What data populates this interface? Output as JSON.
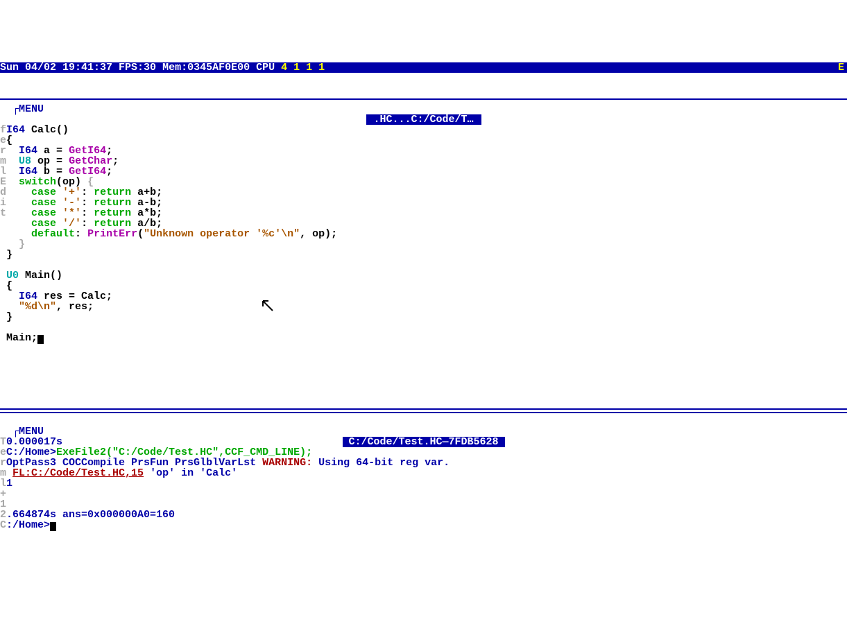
{
  "status": {
    "datetime": "Sun 04/02 19:41:37",
    "fps": "FPS:30",
    "mem": "Mem:0345AF0E00",
    "cpu_label": "CPU",
    "cpu_values": "4 1 1 1",
    "right": "E"
  },
  "editor": {
    "menu_label": "┌MENU",
    "side_text": "Term\nlEdit",
    "title": " .HC...C:/Code/T… ",
    "lines": [
      {
        "side": "f",
        "seg": [
          [
            "blue",
            "I64 "
          ],
          [
            "black",
            "Calc()"
          ]
        ]
      },
      {
        "side": "e",
        "seg": [
          [
            "black",
            "{"
          ]
        ]
      },
      {
        "side": "r",
        "seg": [
          [
            "black",
            "  "
          ],
          [
            "blue",
            "I64 "
          ],
          [
            "black",
            "a = "
          ],
          [
            "purple",
            "GetI64"
          ],
          [
            "black",
            ";"
          ]
        ]
      },
      {
        "side": "m",
        "seg": [
          [
            "black",
            "  "
          ],
          [
            "cyan",
            "U8 "
          ],
          [
            "black",
            "op = "
          ],
          [
            "purple",
            "GetChar"
          ],
          [
            "black",
            ";"
          ]
        ]
      },
      {
        "side": "l",
        "seg": [
          [
            "black",
            "  "
          ],
          [
            "blue",
            "I64 "
          ],
          [
            "black",
            "b = "
          ],
          [
            "purple",
            "GetI64"
          ],
          [
            "black",
            ";"
          ]
        ]
      },
      {
        "side": "E",
        "seg": [
          [
            "black",
            "  "
          ],
          [
            "green",
            "switch"
          ],
          [
            "black",
            "(op) "
          ],
          [
            "gray",
            "{"
          ]
        ]
      },
      {
        "side": "d",
        "seg": [
          [
            "black",
            "    "
          ],
          [
            "green",
            "case "
          ],
          [
            "dkyellow",
            "'+'"
          ],
          [
            "black",
            ": "
          ],
          [
            "green",
            "return "
          ],
          [
            "black",
            "a+b;"
          ]
        ]
      },
      {
        "side": "i",
        "seg": [
          [
            "black",
            "    "
          ],
          [
            "green",
            "case "
          ],
          [
            "dkyellow",
            "'-'"
          ],
          [
            "black",
            ": "
          ],
          [
            "green",
            "return "
          ],
          [
            "black",
            "a-b;"
          ]
        ]
      },
      {
        "side": "t",
        "seg": [
          [
            "black",
            "    "
          ],
          [
            "green",
            "case "
          ],
          [
            "dkyellow",
            "'*'"
          ],
          [
            "black",
            ": "
          ],
          [
            "green",
            "return "
          ],
          [
            "black",
            "a*b;"
          ]
        ]
      },
      {
        "side": " ",
        "seg": [
          [
            "black",
            "    "
          ],
          [
            "green",
            "case "
          ],
          [
            "dkyellow",
            "'/'"
          ],
          [
            "black",
            ": "
          ],
          [
            "green",
            "return "
          ],
          [
            "black",
            "a/b;"
          ]
        ]
      },
      {
        "side": " ",
        "seg": [
          [
            "black",
            "    "
          ],
          [
            "green",
            "default"
          ],
          [
            "black",
            ": "
          ],
          [
            "purple",
            "PrintErr"
          ],
          [
            "black",
            "("
          ],
          [
            "dkyellow",
            "\"Unknown operator '%c'\\n\""
          ],
          [
            "black",
            ", op);"
          ]
        ]
      },
      {
        "side": " ",
        "seg": [
          [
            "black",
            "  "
          ],
          [
            "gray",
            "}"
          ]
        ]
      },
      {
        "side": " ",
        "seg": [
          [
            "black",
            "}"
          ]
        ]
      },
      {
        "side": " ",
        "seg": [
          [
            "black",
            ""
          ]
        ]
      },
      {
        "side": " ",
        "seg": [
          [
            "cyan",
            "U0 "
          ],
          [
            "black",
            "Main()"
          ]
        ]
      },
      {
        "side": " ",
        "seg": [
          [
            "black",
            "{"
          ]
        ]
      },
      {
        "side": " ",
        "seg": [
          [
            "black",
            "  "
          ],
          [
            "blue",
            "I64 "
          ],
          [
            "black",
            "res = Calc;"
          ]
        ]
      },
      {
        "side": " ",
        "seg": [
          [
            "black",
            "  "
          ],
          [
            "dkyellow",
            "\"%d\\n\""
          ],
          [
            "black",
            ", res;"
          ]
        ]
      },
      {
        "side": " ",
        "seg": [
          [
            "black",
            "}"
          ]
        ]
      },
      {
        "side": " ",
        "seg": [
          [
            "black",
            ""
          ]
        ]
      },
      {
        "side": " ",
        "seg": [
          [
            "black",
            "Main;"
          ],
          [
            "cursor",
            ""
          ]
        ]
      }
    ]
  },
  "terminal": {
    "menu_label": "┌MENU",
    "title": " C:/Code/Test.HC—7FDB5628 ",
    "lines": [
      {
        "side": "T",
        "seg": [
          [
            "blue",
            "0.000017s"
          ]
        ]
      },
      {
        "side": "e",
        "seg": [
          [
            "blue",
            "C:/Home>"
          ],
          [
            "green",
            "ExeFile2(\"C:/Code/Test.HC\",CCF_CMD_LINE);"
          ]
        ]
      },
      {
        "side": "r",
        "seg": [
          [
            "blue",
            "OptPass3 COCCompile PrsFun PrsGlblVarLst "
          ],
          [
            "red",
            "WARNING: "
          ],
          [
            "blue",
            "Using 64-bit reg var."
          ]
        ]
      },
      {
        "side": "m",
        "seg": [
          [
            "black",
            " "
          ],
          [
            "redul",
            "FL:C:/Code/Test.HC,15"
          ],
          [
            "blue",
            " 'op' in 'Calc'"
          ]
        ]
      },
      {
        "side": "l",
        "seg": [
          [
            "blue",
            "1"
          ]
        ]
      },
      {
        "side": "+",
        "seg": [
          [
            "blue",
            ""
          ]
        ]
      },
      {
        "side": "1",
        "seg": [
          [
            "blue",
            ""
          ]
        ]
      },
      {
        "side": "2",
        "seg": [
          [
            "blue",
            ".664874s ans=0x000000A0=160"
          ]
        ]
      },
      {
        "side": "C",
        "seg": [
          [
            "blue",
            ":/Home>"
          ],
          [
            "cursor",
            ""
          ]
        ]
      }
    ]
  }
}
